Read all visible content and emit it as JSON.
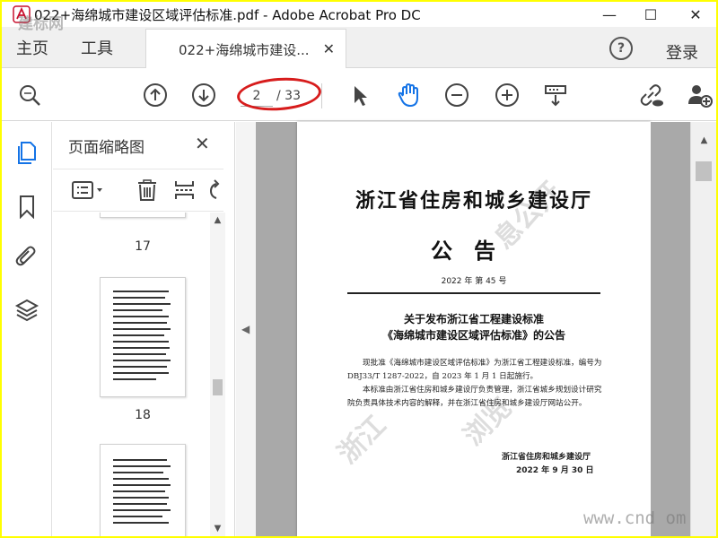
{
  "window": {
    "title": "022+海绵城市建设区域评估标准.pdf - Adobe Acrobat Pro DC",
    "minimize": "—",
    "maximize": "☐",
    "close": "✕"
  },
  "tabs": {
    "home": "主页",
    "tools": "工具",
    "document": "022+海绵城市建设...",
    "document_close": "✕",
    "help": "?",
    "login": "登录"
  },
  "toolbar": {
    "current_page": "2",
    "total_pages": "/ 33",
    "icons": [
      "search-zoom-icon",
      "page-up-icon",
      "page-down-icon",
      "select-arrow-icon",
      "hand-icon",
      "zoom-out-icon",
      "zoom-in-icon",
      "scroll-mode-icon",
      "share-link-icon",
      "add-user-icon"
    ]
  },
  "thumbnails_panel": {
    "title": "页面缩略图",
    "close": "✕",
    "labels": [
      "17",
      "18"
    ]
  },
  "document": {
    "department": "浙江省住房和城乡建设厅",
    "doc_type": "公告",
    "doc_number": "2022 年 第 45 号",
    "heading_line1": "关于发布浙江省工程建设标准",
    "heading_line2": "《海绵城市建设区域评估标准》的公告",
    "paragraph1": "现批准《海绵城市建设区域评估标准》为浙江省工程建设标准，编号为 DBJ33/T 1287-2022，自 2023 年 1 月 1 日起施行。",
    "paragraph2": "本标准由浙江省住房和城乡建设厅负责管理，浙江省城乡规划设计研究院负责具体技术内容的解释，并在浙江省住房和城乡建设厅网站公开。",
    "signature": "浙江省住房和城乡建设厅",
    "date": "2022 年 9 月 30 日"
  },
  "watermarks": {
    "page_top": "息公开",
    "page_left": "浙江",
    "page_right": "浏览",
    "site": "www.cnd  om",
    "logo": "建标网"
  },
  "colors": {
    "frame_border": "#ffff00",
    "highlight": "#d71c1c",
    "accent_blue": "#1473e6"
  }
}
